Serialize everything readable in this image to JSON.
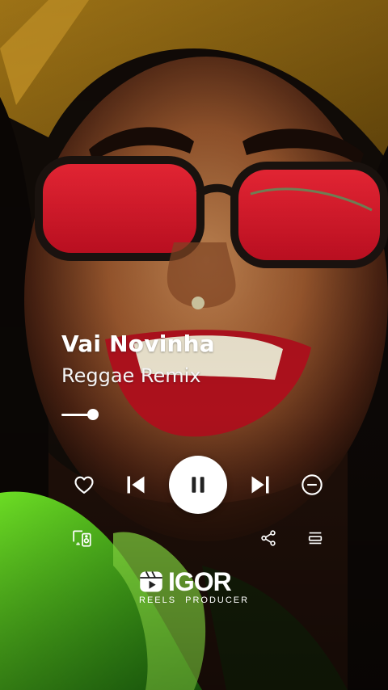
{
  "track": {
    "title": "Vai Novinha",
    "artist": "Reggae Remix"
  },
  "progress": {
    "fraction": 0.85
  },
  "controls": {
    "like_icon": "heart-icon",
    "prev_icon": "skip-previous-icon",
    "play_pause_icon": "pause-icon",
    "next_icon": "skip-next-icon",
    "remove_icon": "minus-circle-icon"
  },
  "bottom": {
    "device_icon": "connect-device-icon",
    "share_icon": "share-icon",
    "queue_icon": "queue-icon"
  },
  "watermark": {
    "main": "IGOR",
    "sub_left": "REELS",
    "sub_right": "PRODUCER"
  },
  "colors": {
    "text": "#ffffff",
    "play_button_bg": "#ffffff",
    "play_icon": "#222222"
  }
}
